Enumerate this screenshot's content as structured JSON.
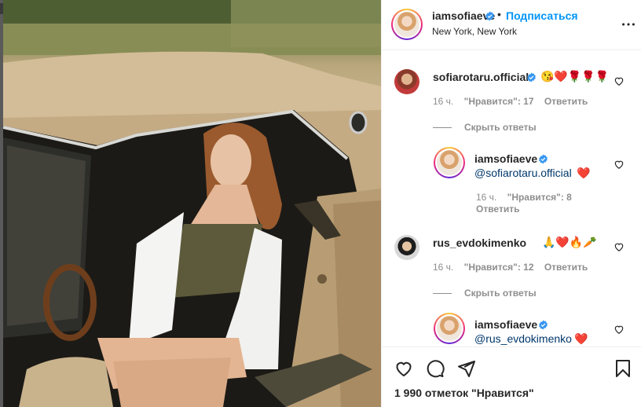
{
  "post": {
    "author": "iamsofiaeve",
    "follow_label": "Подписаться",
    "dot": "•",
    "location": "New York, New York",
    "likes_text": "1 990 отметок \"Нравится\""
  },
  "comments": [
    {
      "username": "sofiarotaru.official",
      "emoji": "😘❤️🌹🌹🌹",
      "time": "16 ч.",
      "likes": "\"Нравится\": 17",
      "reply_label": "Ответить",
      "hide_replies": "Скрыть ответы",
      "reply": {
        "username": "iamsofiaeve",
        "mention": "@sofiarotaru.official",
        "emoji": "❤️",
        "time": "16 ч.",
        "likes": "\"Нравится\": 8",
        "reply_label": "Ответить"
      }
    },
    {
      "username": "rus_evdokimenko",
      "emoji": "🙏❤️🔥🥕",
      "time": "16 ч.",
      "likes": "\"Нравится\": 12",
      "reply_label": "Ответить",
      "hide_replies": "Скрыть ответы",
      "reply": {
        "username": "iamsofiaeve",
        "mention": "@rus_evdokimenko",
        "emoji": "❤️"
      }
    }
  ],
  "icons": {
    "verified": "verified-badge-icon",
    "more": "more-options-icon",
    "like": "heart-icon",
    "comment": "comment-icon",
    "share": "share-icon",
    "save": "bookmark-icon"
  },
  "colors": {
    "link_blue": "#0095f6",
    "mention_blue": "#00376b",
    "muted": "#8e8e8e",
    "heart_red": "#ed4956"
  }
}
